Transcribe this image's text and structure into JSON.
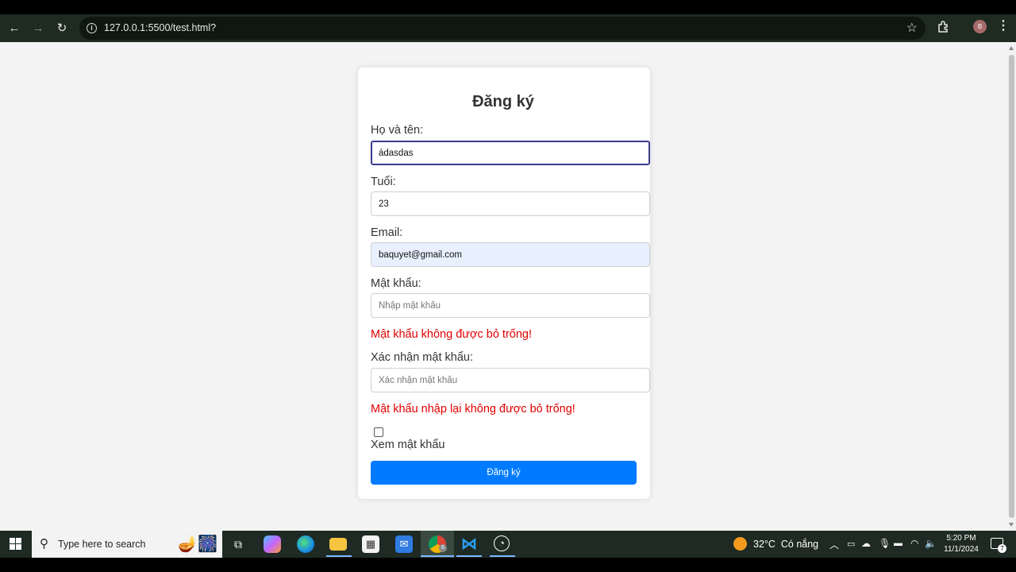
{
  "browser": {
    "url": "127.0.0.1:5500/test.html?",
    "profile_initial": "B"
  },
  "form": {
    "title": "Đăng ký",
    "name_label": "Họ và tên:",
    "name_value": "ádasdas",
    "age_label": "Tuổi:",
    "age_value": "23",
    "email_label": "Email:",
    "email_value": "baquyet@gmail.com",
    "password_label": "Mật khẩu:",
    "password_placeholder": "Nhập mật khẩu",
    "password_error": "Mật khẩu không được bỏ trống!",
    "confirm_label": "Xác nhận mật khẩu:",
    "confirm_placeholder": "Xác nhận mật khẩu",
    "confirm_error": "Mật khẩu nhập lại không được bỏ trống!",
    "show_password_label": "Xem mật khẩu",
    "show_password_checked": false,
    "submit_label": "Đăng ký",
    "accent_color": "#007bff",
    "error_color": "#e00000"
  },
  "taskbar": {
    "search_placeholder": "Type here to search",
    "weather": "32°C  Có nắng",
    "time": "5:20 PM",
    "date": "11/1/2024",
    "notification_count": "7",
    "chrome_badge": "6"
  }
}
